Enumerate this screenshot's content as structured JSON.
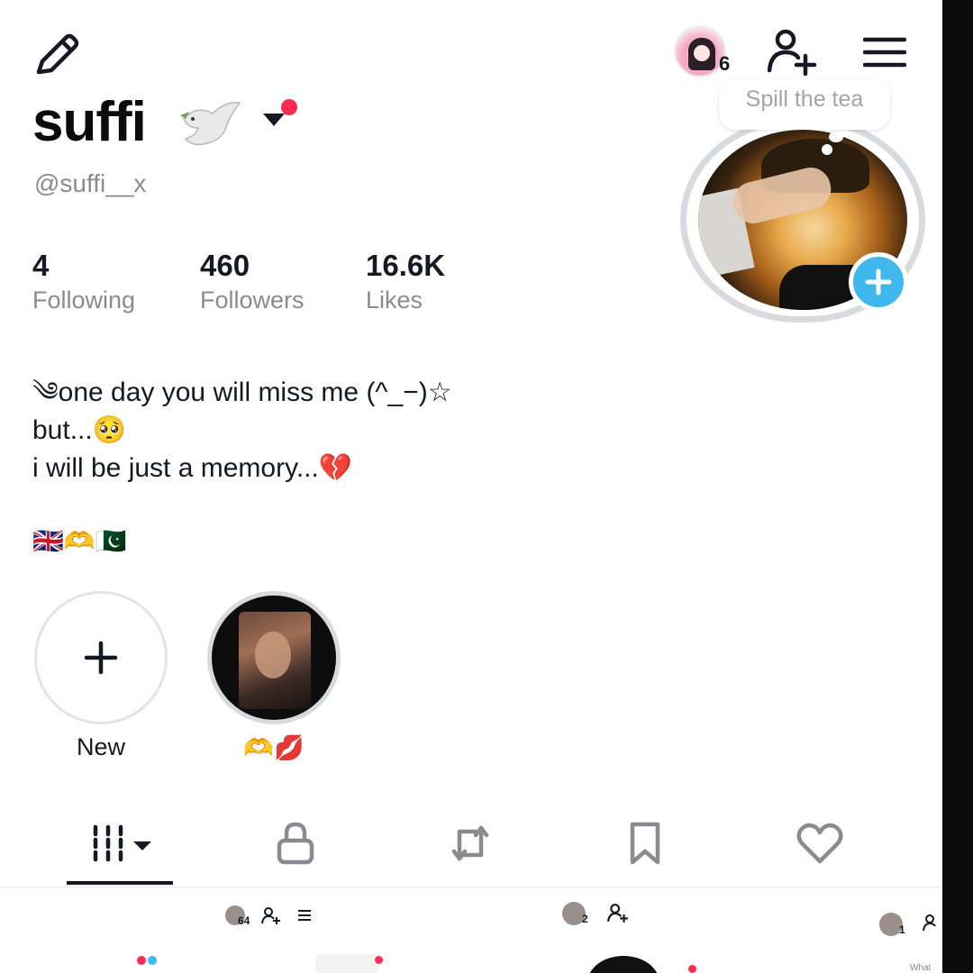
{
  "header": {
    "edit_icon": "pencil-icon",
    "avatar_count": "6",
    "add_friend_icon": "person-add-icon",
    "menu_icon": "hamburger-menu-icon"
  },
  "profile": {
    "display_name": "suffi",
    "handle": "@suffi__x",
    "note_bubble": "Spill the tea",
    "add_photo_icon": "plus-icon"
  },
  "stats": [
    {
      "value": "4",
      "label": "Following"
    },
    {
      "value": "460",
      "label": "Followers"
    },
    {
      "value": "16.6K",
      "label": "Likes"
    }
  ],
  "bio": {
    "line1": "༄one day you will miss me (^_−)☆",
    "line2": "but...🥺",
    "line3": "i will be just a memory...💔",
    "line4": "🇬🇧🫶🇵🇰"
  },
  "highlights": [
    {
      "label": "New",
      "icon": "plus-icon"
    },
    {
      "label": "🫶💋"
    }
  ],
  "tabs": [
    {
      "name": "videos",
      "icon": "grid-icon"
    },
    {
      "name": "private",
      "icon": "lock-icon"
    },
    {
      "name": "reposts",
      "icon": "repost-icon"
    },
    {
      "name": "favorites",
      "icon": "bookmark-icon"
    },
    {
      "name": "liked",
      "icon": "heart-icon"
    }
  ],
  "preview_strip": {
    "counts": [
      "64",
      "2",
      "1"
    ],
    "peek_text": "What"
  },
  "colors": {
    "accent_red": "#fe2c55",
    "accent_blue": "#3fb8ee",
    "text_primary": "#161823",
    "text_secondary": "#8a8b91"
  }
}
